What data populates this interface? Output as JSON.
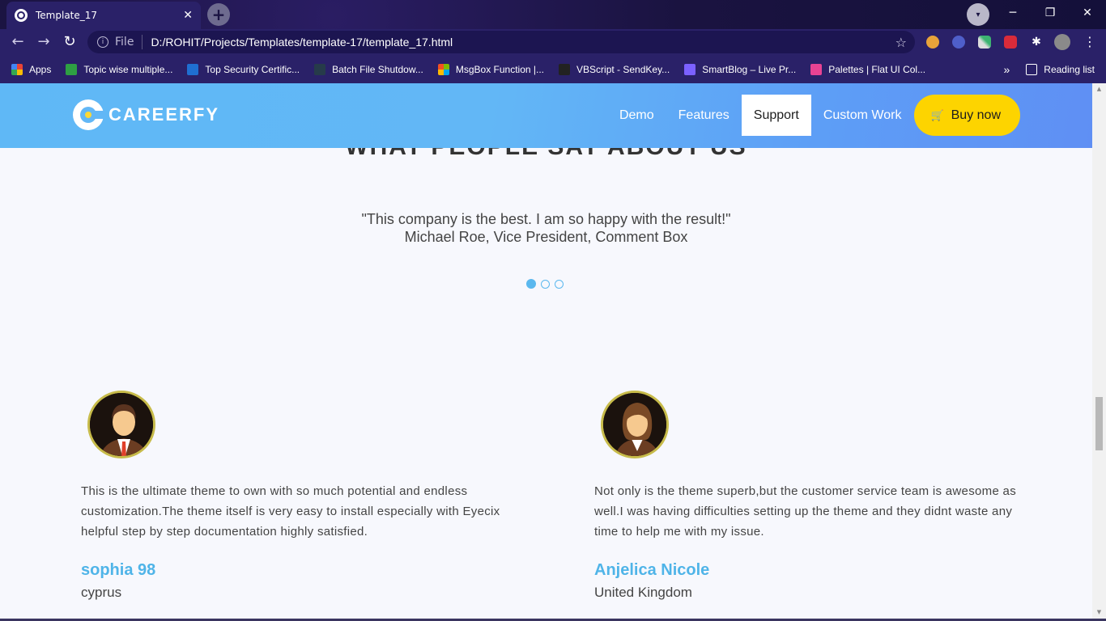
{
  "browser": {
    "tab_title": "Template_17",
    "url_scheme": "File",
    "url": "D:/ROHIT/Projects/Templates/template-17/template_17.html",
    "bookmarks": [
      {
        "label": "Apps",
        "color": "#e94235"
      },
      {
        "label": "Topic wise multiple...",
        "color": "#2ea043"
      },
      {
        "label": "Top Security Certific...",
        "color": "#1f6fd1"
      },
      {
        "label": "Batch File Shutdow...",
        "color": "#263b4a"
      },
      {
        "label": "MsgBox Function |...",
        "color": "#f25022"
      },
      {
        "label": "VBScript - SendKey...",
        "color": "#222222"
      },
      {
        "label": "SmartBlog – Live Pr...",
        "color": "#7b61ff"
      },
      {
        "label": "Palettes | Flat UI Col...",
        "color": "#e84393"
      }
    ],
    "reading_list": "Reading list"
  },
  "site": {
    "brand": "CAREERFY",
    "nav": {
      "demo": "Demo",
      "features": "Features",
      "support": "Support",
      "custom_work": "Custom Work",
      "buy_now": "Buy now"
    },
    "active_nav": "Support",
    "accent_color": "#5fb8f6",
    "buy_color": "#fdd400"
  },
  "testimonial_section": {
    "heading": "WHAT PEOPLE SAY ABOUT US",
    "quote": "\"This company is the best. I am so happy with the result!\"",
    "author": "Michael Roe, Vice President, Comment Box",
    "active_slide": 1,
    "slide_count": 3
  },
  "testimonials": [
    {
      "text": "This is the ultimate theme to own with so much potential and endless customization.The theme itself is very easy to install especially with Eyecix helpful step by step documentation highly satisfied.",
      "name": "sophia 98",
      "place": "cyprus",
      "avatar": "male-avatar-icon"
    },
    {
      "text": "Not only is the theme superb,but the customer service team is awesome as well.I was having difficulties setting up the theme and they didnt waste any time to help me with my issue.",
      "name": "Anjelica Nicole",
      "place": "United Kingdom",
      "avatar": "female-avatar-icon"
    }
  ]
}
